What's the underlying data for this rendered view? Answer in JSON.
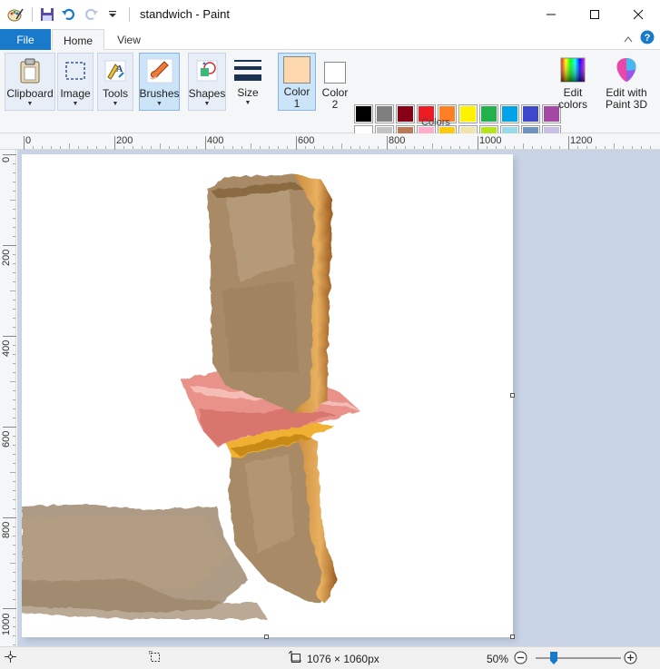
{
  "app": {
    "title": "standwich - Paint"
  },
  "tabs": {
    "file": "File",
    "home": "Home",
    "view": "View"
  },
  "ribbon": {
    "clipboard": "Clipboard",
    "image": "Image",
    "tools": "Tools",
    "brushes": "Brushes",
    "shapes": "Shapes",
    "size": "Size",
    "color1": "Color 1",
    "color2": "Color 2",
    "colors_group": "Colors",
    "edit_colors": "Edit colors",
    "edit_paint3d": "Edit with Paint 3D",
    "color1_value": "#fdd7ae",
    "color2_value": "#ffffff"
  },
  "palette": [
    "#000000",
    "#7f7f7f",
    "#880015",
    "#ed1c24",
    "#ff7f27",
    "#fff200",
    "#22b14c",
    "#00a2e8",
    "#3f48cc",
    "#a349a4",
    "#ffffff",
    "#c3c3c3",
    "#b97a57",
    "#ffaec9",
    "#ffc90e",
    "#efe4b0",
    "#b5e61d",
    "#99d9ea",
    "#7092be",
    "#c8bfe7",
    "#fcd5c8",
    "#7a4a1d",
    "#5b3c12",
    "#a98060",
    "#b59273",
    "#b89a7a",
    "#c78a3c",
    "#e4a35e",
    "#f0d0a8",
    "#fbe6dc"
  ],
  "ruler_h": [
    "0",
    "200",
    "400",
    "600",
    "800",
    "1000",
    "1200"
  ],
  "ruler_v": [
    "0",
    "200",
    "400",
    "600",
    "800",
    "1000"
  ],
  "status": {
    "dimensions": "1076 × 1060px",
    "zoom": "50%"
  }
}
